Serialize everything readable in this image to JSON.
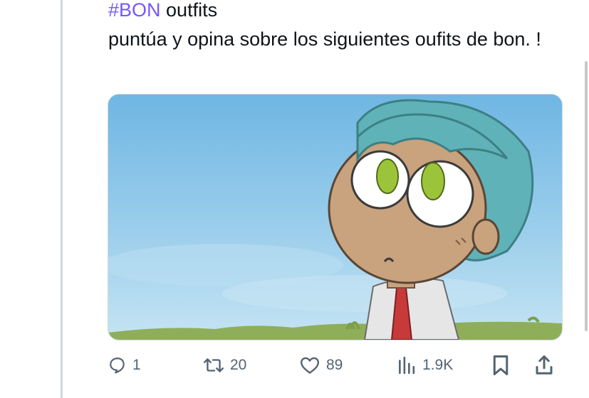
{
  "tweet": {
    "hashtag": "#BON",
    "title_rest": " outfits",
    "body": "puntúa y opina sobre los siguientes oufits de bon. !"
  },
  "media": {
    "description_icon": "cartoon-character-image"
  },
  "actions": {
    "reply_count": "1",
    "retweet_count": "20",
    "like_count": "89",
    "views_count": "1.9K"
  },
  "colors": {
    "hashtag": "#7856ff",
    "icon": "#536471",
    "thread_line": "#cfd9de"
  }
}
